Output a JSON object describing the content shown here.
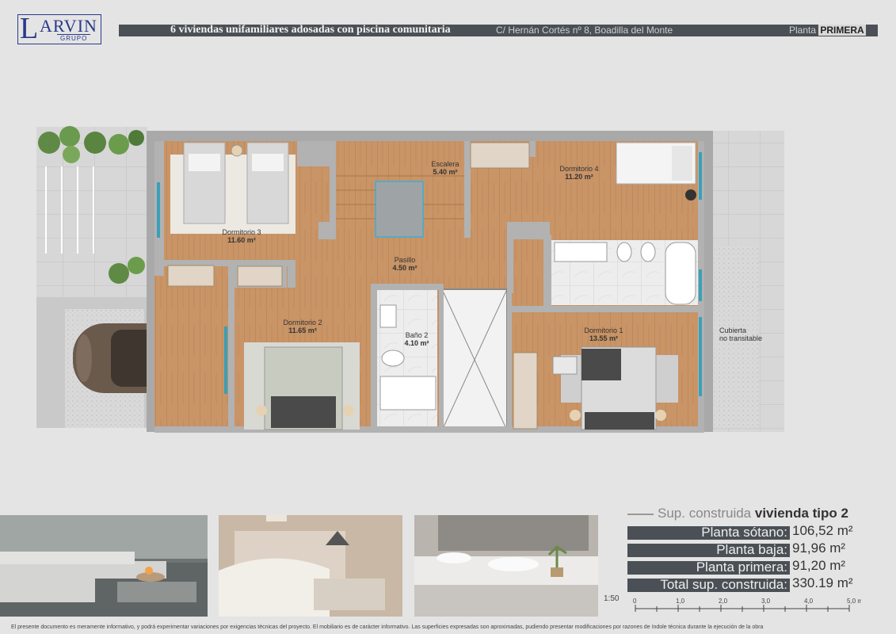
{
  "brand": {
    "name": "ARVIN",
    "initial": "L",
    "subtitle": "GRUPO"
  },
  "header": {
    "title": "6 viviendas unifamiliares adosadas con piscina comunitaria",
    "address": "C/ Hernán Cortés nº 8, Boadilla del Monte",
    "floor_prefix": "Planta",
    "floor_name": "PRIMERA"
  },
  "rooms": [
    {
      "name": "Dormitorio 3",
      "area": "11.60 m²"
    },
    {
      "name": "Escalera",
      "area": "5.40 m²"
    },
    {
      "name": "Dormitorio 4",
      "area": "11.20 m²"
    },
    {
      "name": "Pasillo",
      "area": "4.50 m²"
    },
    {
      "name": "Dormitorio 2",
      "area": "11.65 m²"
    },
    {
      "name": "Baño 2",
      "area": "4.10 m²"
    },
    {
      "name": "Dormitorio 1",
      "area": "13.55 m²"
    },
    {
      "name": "Cubierta",
      "area": "no transitable"
    }
  ],
  "surfaces": {
    "title_prefix": "Sup. construida",
    "title_bold": "vivienda tipo 2",
    "rows": [
      {
        "label": "Planta sótano:",
        "value": "106,52 m²"
      },
      {
        "label": "Planta baja:",
        "value": "91,96 m²"
      },
      {
        "label": "Planta primera:",
        "value": "91,20 m²"
      },
      {
        "label": "Total sup. construida:",
        "value": "330.19 m²"
      }
    ]
  },
  "scale": {
    "label": "1:50",
    "ticks": [
      "0",
      "1,0",
      "2,0",
      "3,0",
      "4,0",
      "5,0 m"
    ]
  },
  "photos": [
    "outdoor-lounge-photo",
    "bedroom-photo",
    "bathroom-photo"
  ],
  "disclaimer": "El presente documento es meramente informativo, y podrá experimentar variaciones por exigencias técnicas del proyecto. El mobiliario es de carácter informativo. Las superficies expresadas son aproximadas, pudiendo presentar modificaciones por razones de índole técnica durante la ejecución de la obra",
  "colors": {
    "header_bar": "#4a5055",
    "brand": "#2a3a8a",
    "wood_floor": "#c99466",
    "tile_floor": "#ececec",
    "window": "#3aa0b8"
  }
}
